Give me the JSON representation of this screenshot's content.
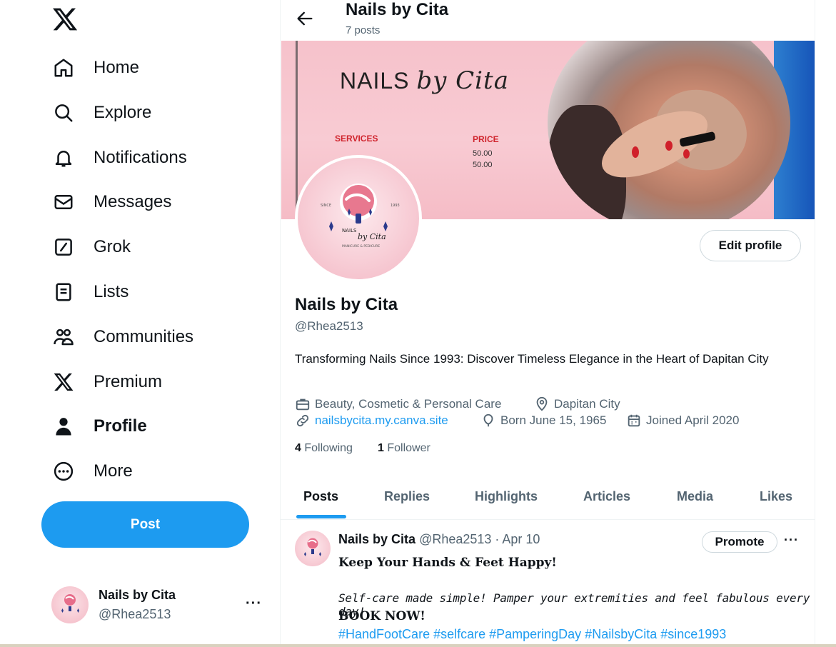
{
  "sidebar": {
    "logo_icon": "x-logo-icon",
    "items": [
      {
        "label": "Home",
        "icon": "home-icon"
      },
      {
        "label": "Explore",
        "icon": "search-icon"
      },
      {
        "label": "Notifications",
        "icon": "bell-icon"
      },
      {
        "label": "Messages",
        "icon": "envelope-icon"
      },
      {
        "label": "Grok",
        "icon": "grok-icon"
      },
      {
        "label": "Lists",
        "icon": "list-icon"
      },
      {
        "label": "Communities",
        "icon": "people-icon"
      },
      {
        "label": "Premium",
        "icon": "x-logo-icon"
      },
      {
        "label": "Profile",
        "icon": "person-icon"
      },
      {
        "label": "More",
        "icon": "more-circle-icon"
      }
    ],
    "post_label": "Post",
    "account": {
      "name": "Nails by Cita",
      "handle": "@Rhea2513",
      "more": "···"
    }
  },
  "header": {
    "name": "Nails by Cita",
    "posts_count": "7 posts"
  },
  "banner": {
    "title": "NAILS",
    "title_script": "by Cita",
    "services_label": "SERVICES",
    "price_label": "PRICE",
    "prices": [
      "50.00",
      "50.00"
    ]
  },
  "profile": {
    "edit_label": "Edit profile",
    "name": "Nails by Cita",
    "handle": "@Rhea2513",
    "bio": "Transforming Nails Since 1993: Discover Timeless Elegance in the Heart of Dapitan City",
    "category": "Beauty, Cosmetic & Personal Care",
    "location": "Dapitan City",
    "website": "nailsbycita.my.canva.site",
    "born": "Born June 15, 1965",
    "joined": "Joined April 2020",
    "following_count": "4",
    "following_label": "Following",
    "followers_count": "1",
    "followers_label": "Follower"
  },
  "tabs": [
    "Posts",
    "Replies",
    "Highlights",
    "Articles",
    "Media",
    "Likes"
  ],
  "post": {
    "name": "Nails by Cita",
    "meta": "@Rhea2513 · Apr 10",
    "promote_label": "Promote",
    "more": "···",
    "line1": "Keep Your Hands & Feet Happy!",
    "line2": "Self-care made simple! Pamper your extremities and feel fabulous every day!",
    "line3": "BOOK NOW!",
    "hashtags": "#HandFootCare #selfcare #PamperingDay #NailsbyCita #since1993"
  },
  "colors": {
    "accent": "#1d9bf0",
    "text": "#0f1419",
    "muted": "#536471",
    "banner_pink": "#f7c6cf"
  }
}
